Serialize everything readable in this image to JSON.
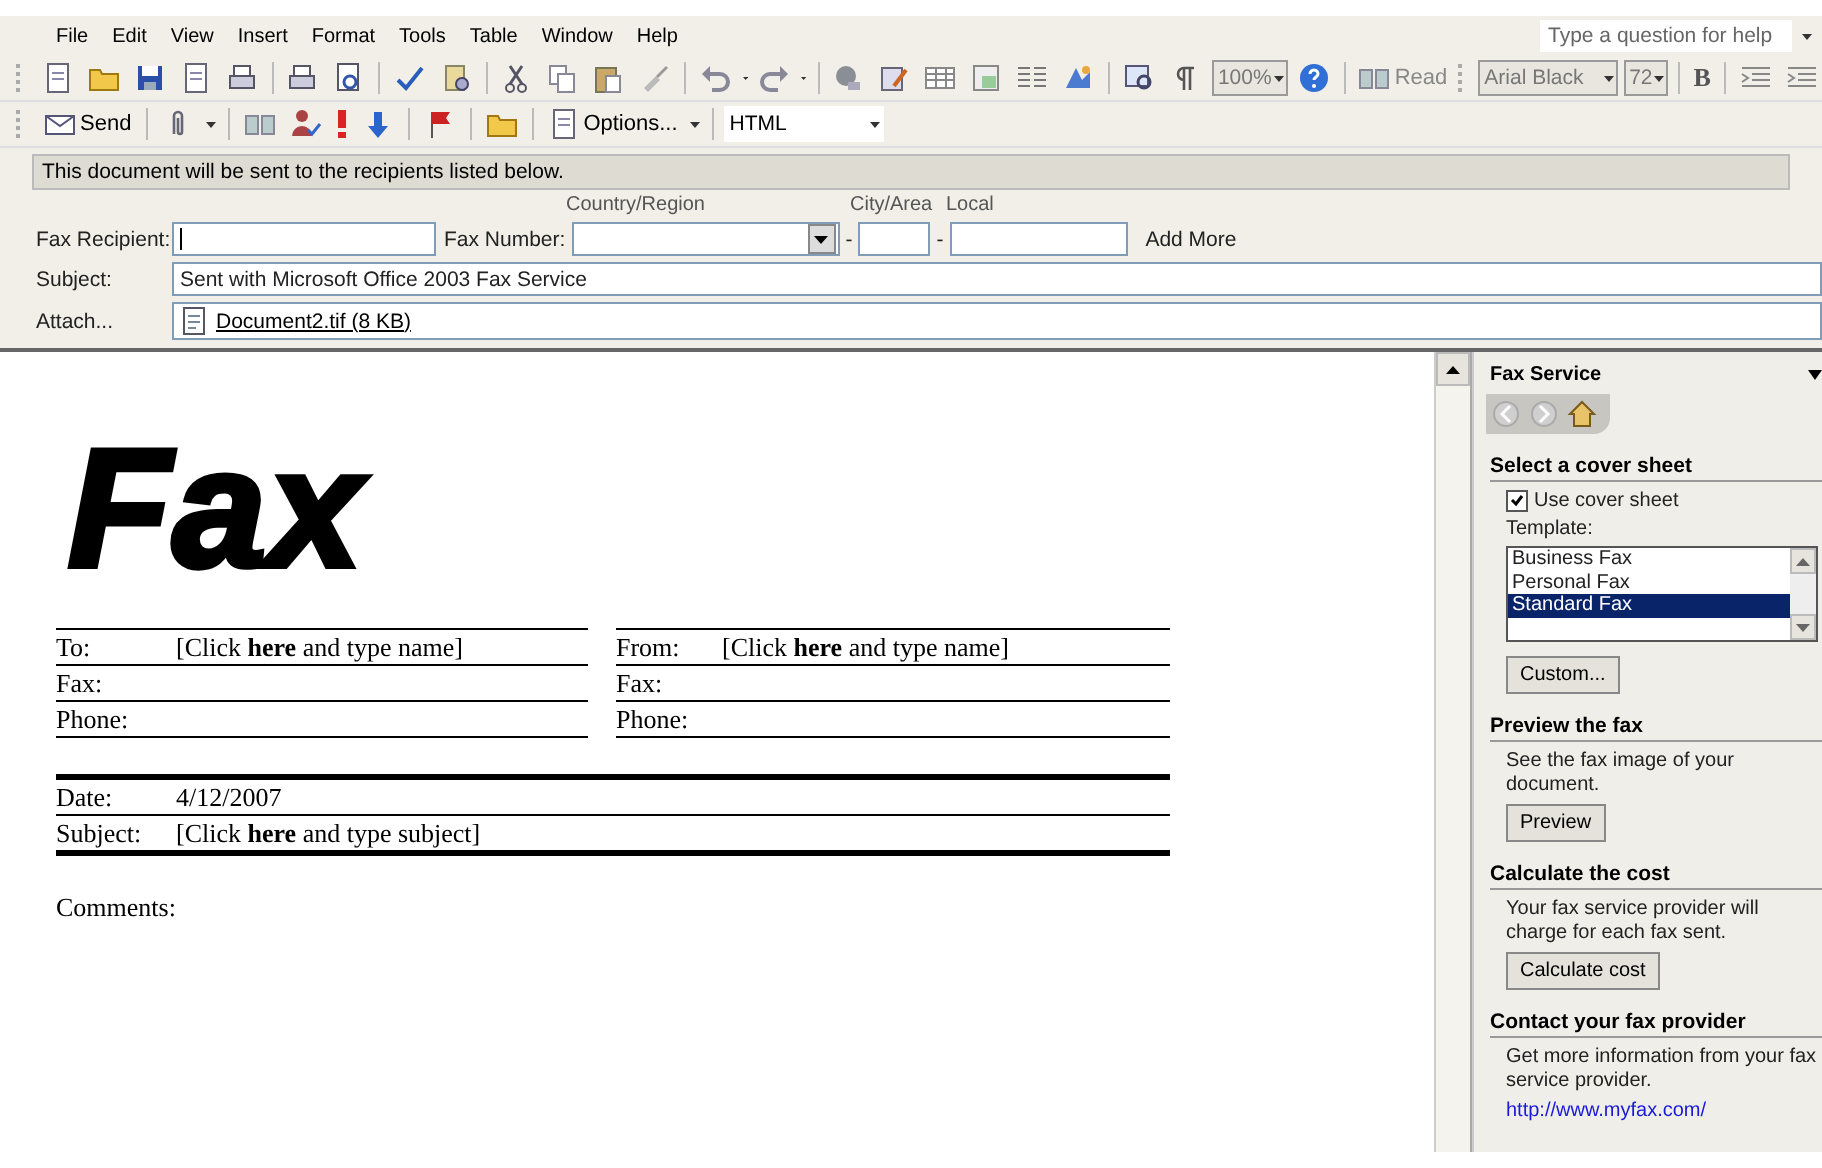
{
  "menu": [
    {
      "label": "File"
    },
    {
      "label": "Edit"
    },
    {
      "label": "View"
    },
    {
      "label": "Insert"
    },
    {
      "label": "Format"
    },
    {
      "label": "Tools"
    },
    {
      "label": "Table"
    },
    {
      "label": "Window"
    },
    {
      "label": "Help"
    }
  ],
  "help_box": {
    "placeholder": "Type a question for help"
  },
  "standard_toolbar": {
    "zoom": "100%",
    "read": "Read",
    "font": "Arial Black",
    "font_size": "72",
    "bold": "B"
  },
  "mail_toolbar": {
    "send": "Send",
    "options": "Options...",
    "format": "HTML"
  },
  "info_bar": "This document will be sent to the recipients listed below.",
  "fax_header": {
    "recipient_label": "Fax Recipient:",
    "number_label": "Fax Number:",
    "country_label": "Country/Region",
    "city_label": "City/Area",
    "local_label": "Local",
    "separators": [
      "-",
      "-"
    ],
    "add_more": "Add More",
    "subject_label": "Subject:",
    "subject": "Sent with Microsoft Office 2003 Fax Service",
    "attach_label": "Attach...",
    "attachment": "Document2.tif (8 KB)"
  },
  "document": {
    "title": "Fax",
    "to_block": [
      {
        "label": "To:",
        "value": "[Click **here** and type name]"
      },
      {
        "label": "Fax:"
      },
      {
        "label": "Phone:"
      }
    ],
    "from_block": [
      {
        "label": "From:",
        "value": "[Click **here** and type name]"
      },
      {
        "label": "Fax:"
      },
      {
        "label": "Phone:"
      }
    ],
    "details": [
      {
        "label": "Date:",
        "value": "4/12/2007"
      },
      {
        "label": "Subject:",
        "value": "[Click **here** and type subject]"
      }
    ],
    "comments_label": "Comments:"
  },
  "task_pane": {
    "title": "Fax Service",
    "cover": {
      "heading": "Select a cover sheet",
      "use_cover_sheet": {
        "label": "Use cover sheet",
        "checked": true
      },
      "template_label": "Template:",
      "templates": [
        {
          "name": "Business Fax",
          "selected": false
        },
        {
          "name": "Personal Fax",
          "selected": false
        },
        {
          "name": "Standard Fax",
          "selected": true
        }
      ],
      "button": "Custom..."
    },
    "preview": {
      "heading": "Preview the fax",
      "text": "See the fax image of your document.",
      "button": "Preview"
    },
    "cost": {
      "heading": "Calculate the cost",
      "text": "Your fax service provider will charge for each fax sent.",
      "button": "Calculate cost"
    },
    "contact": {
      "heading": "Contact your fax provider",
      "text": "Get more information from your fax service provider.",
      "link": "http://www.myfax.com/"
    }
  }
}
